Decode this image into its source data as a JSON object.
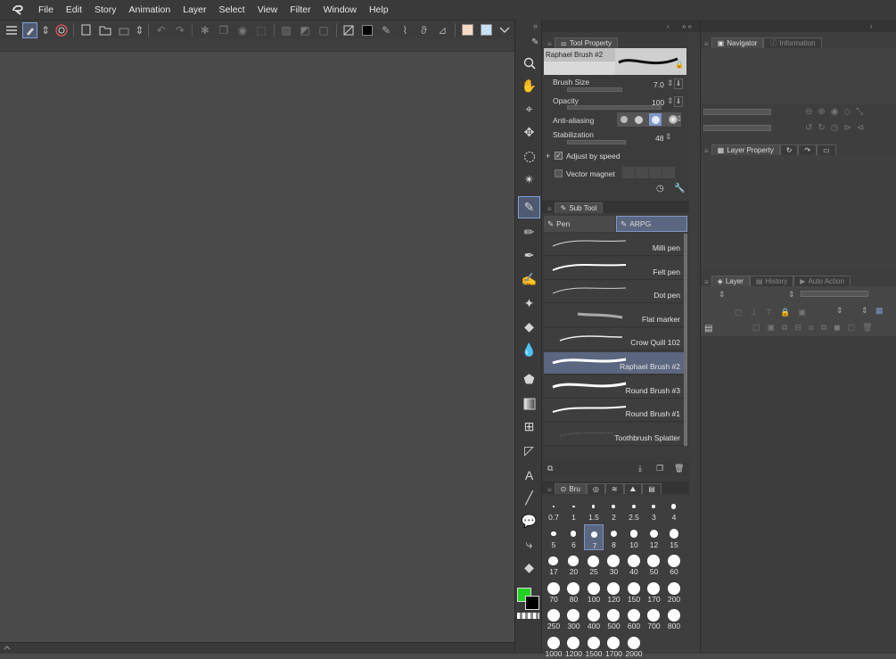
{
  "menu": [
    "File",
    "Edit",
    "Story",
    "Animation",
    "Layer",
    "Select",
    "View",
    "Filter",
    "Window",
    "Help"
  ],
  "colors": {
    "main": "#22d022",
    "sub": "#000000",
    "toolbar_swatch1": "#000000",
    "toolbar_swatch2": "#f7d9c4",
    "toolbar_swatch3": "#c7e1f7",
    "accent": "#5b6680"
  },
  "tool_property": {
    "tab": "Tool Property",
    "preset_name": "Raphael Brush #2",
    "brush_size_label": "Brush Size",
    "brush_size": "7.0",
    "opacity_label": "Opacity",
    "opacity": "100",
    "antialias_label": "Anti-aliasing",
    "stabilization_label": "Stabilization",
    "stabilization": "48",
    "adjust_label": "Adjust by speed",
    "vector_label": "Vector magnet"
  },
  "sub_tool": {
    "tab": "Sub Tool",
    "groups": [
      "Pen",
      "ARPG"
    ],
    "brushes": [
      "Milli pen",
      "Felt pen",
      "Dot pen",
      "Flat marker",
      "Crow Quill 102",
      "Raphael Brush #2",
      "Round Brush #3",
      "Round Brush #1",
      "Toothbrush Splatter"
    ]
  },
  "brush_size_panel": {
    "tab": "Bru",
    "sizes": [
      "0.7",
      "1",
      "1.5",
      "2",
      "2.5",
      "3",
      "4",
      "5",
      "6",
      "7",
      "8",
      "10",
      "12",
      "15",
      "17",
      "20",
      "25",
      "30",
      "40",
      "50",
      "60",
      "70",
      "80",
      "100",
      "120",
      "150",
      "170",
      "200",
      "250",
      "300",
      "400",
      "500",
      "600",
      "700",
      "800",
      "1000",
      "1200",
      "1500",
      "1700",
      "2000"
    ],
    "selected": "7"
  },
  "navigator": {
    "tab": "Navigator",
    "tab2": "Information"
  },
  "layer_property": {
    "tab": "Layer Property"
  },
  "layer": {
    "tab": "Layer",
    "tab2": "History",
    "tab3": "Auto Action"
  },
  "icons": [
    "logo-icon",
    "menu-icon",
    "new-icon",
    "open-icon",
    "save-icon",
    "undo-icon",
    "redo-icon",
    "hand-icon",
    "zoom-icon",
    "pen-icon",
    "eraser-icon",
    "fill-icon",
    "text-icon"
  ]
}
